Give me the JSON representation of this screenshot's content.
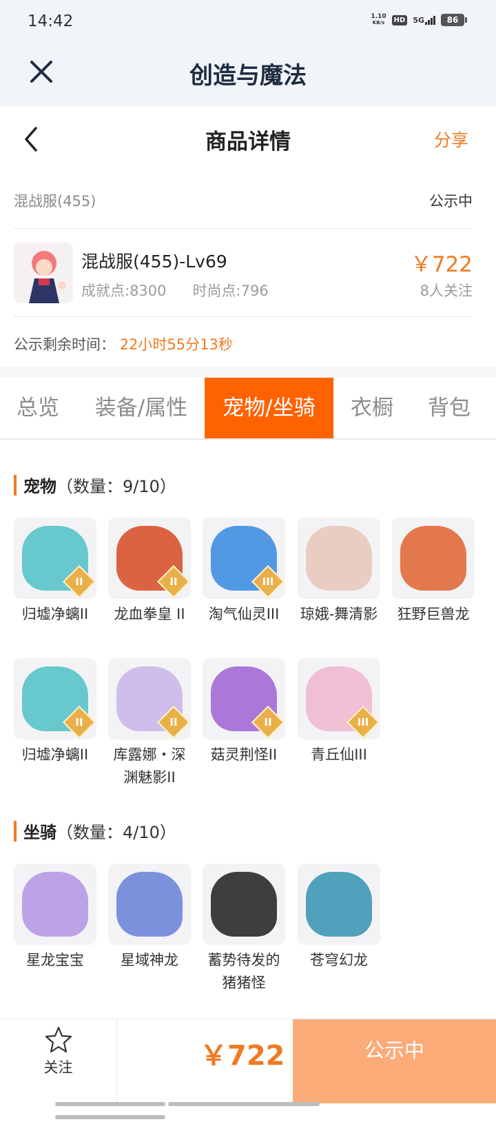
{
  "status_bar": {
    "time": "14:42",
    "speed_value": "1.10",
    "speed_unit": "KB/s",
    "hd": "HD",
    "network": "5G",
    "battery": "86"
  },
  "app_bar": {
    "title": "创造与魔法"
  },
  "nav": {
    "title": "商品详情",
    "share": "分享"
  },
  "listing": {
    "server": "混战服(455)",
    "state": "公示中",
    "name": "混战服(455)-Lv69",
    "achievement": "成就点:8300",
    "fashion": "时尚点:796",
    "price": "￥722",
    "followers": "8人关注",
    "countdown_label": "公示剩余时间：",
    "countdown_value": "22小时55分13秒"
  },
  "tabs": [
    "总览",
    "装备/属性",
    "宠物/坐骑",
    "衣橱",
    "背包"
  ],
  "active_tab": "宠物/坐骑",
  "pets": {
    "title": "宠物",
    "count": "（数量：9/10）",
    "items": [
      {
        "name": "归墟净螭II",
        "tier": "II",
        "color": "#58c4c9"
      },
      {
        "name": "龙血拳皇 II",
        "tier": "II",
        "color": "#d9532e"
      },
      {
        "name": "淘气仙灵III",
        "tier": "III",
        "color": "#3f8fe0"
      },
      {
        "name": "琼娥-舞清影",
        "tier": "",
        "color": "#e9c9bd"
      },
      {
        "name": "狂野巨兽龙",
        "tier": "",
        "color": "#e06a3a"
      },
      {
        "name": "归墟净螭II",
        "tier": "II",
        "color": "#58c4c9"
      },
      {
        "name": "库露娜・深渊魅影II",
        "tier": "II",
        "color": "#cbb8ea"
      },
      {
        "name": "菇灵荆怪II",
        "tier": "II",
        "color": "#a36ad6"
      },
      {
        "name": "青丘仙III",
        "tier": "III",
        "color": "#f0b9d0"
      }
    ]
  },
  "mounts": {
    "title": "坐骑",
    "count": "（数量：4/10）",
    "items": [
      {
        "name": "星龙宝宝",
        "tier": "",
        "color": "#b69ae6"
      },
      {
        "name": "星域神龙",
        "tier": "",
        "color": "#6f86d9"
      },
      {
        "name": "蓄势待发的猪猪怪",
        "tier": "",
        "color": "#2a2a2a"
      },
      {
        "name": "苍穹幻龙",
        "tier": "",
        "color": "#3e98b6"
      }
    ]
  },
  "bottom": {
    "follow": "关注",
    "price": "￥722",
    "action": "公示中"
  }
}
